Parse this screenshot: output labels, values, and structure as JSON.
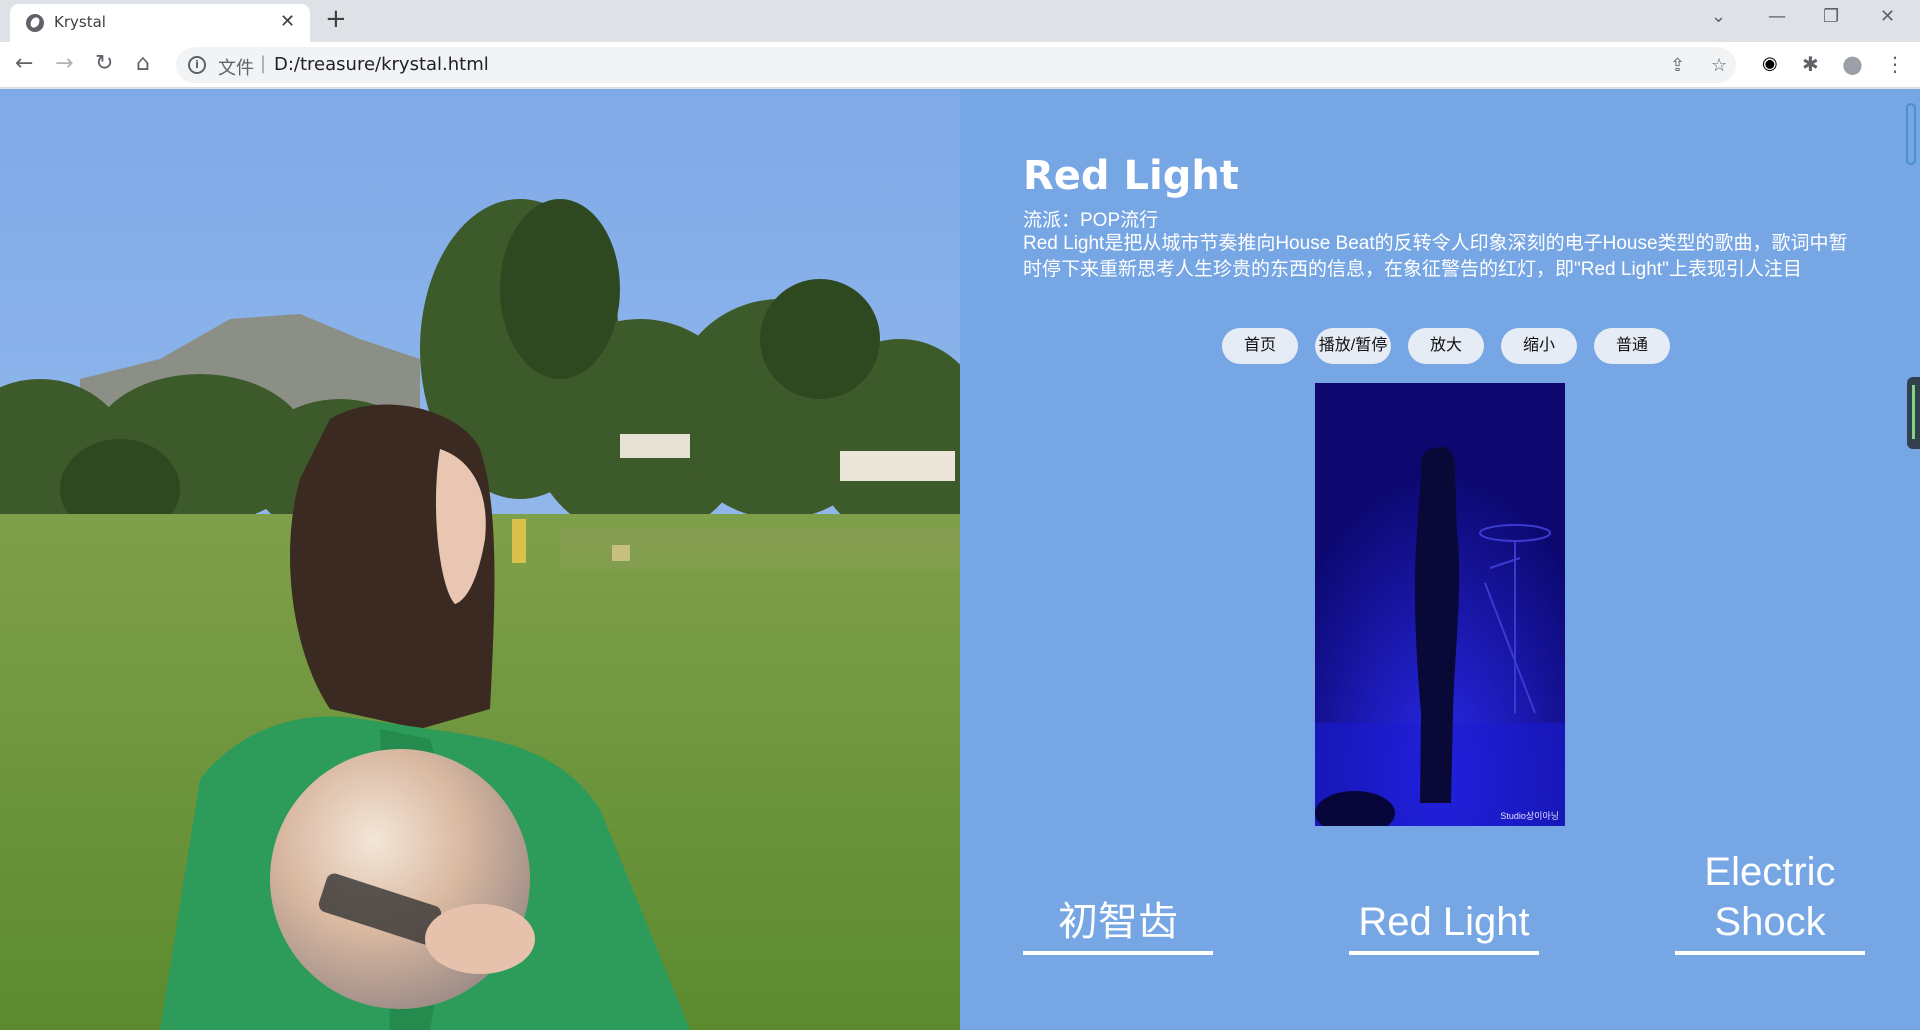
{
  "browser": {
    "tab_title": "Krystal",
    "tab_close": "✕",
    "new_tab": "+",
    "url_scheme": "文件",
    "url_separator": "|",
    "url_path": "D:/treasure/krystal.html",
    "window_controls": {
      "tab_search": "⌄",
      "minimize": "—",
      "restore": "❐",
      "close": "✕"
    },
    "nav": {
      "back": "←",
      "forward": "→",
      "reload": "↻",
      "home": "⌂"
    },
    "omnibox_right": {
      "share": "⇪",
      "bookmark": "☆"
    },
    "toolbar_right": {
      "extension_eye": "◉",
      "extensions": "✱",
      "profile": "●",
      "menu": "⋮"
    }
  },
  "page": {
    "song_title": "Red Light",
    "genre": "流派：POP流行",
    "description": "Red Light是把从城市节奏推向House Beat的反转令人印象深刻的电子House类型的歌曲，歌词中暂时停下来重新思考人生珍贵的东西的信息，在象征警告的红灯，即\"Red Light\"上表现引人注目",
    "controls": [
      "首页",
      "播放/暂停",
      "放大",
      "缩小",
      "普通"
    ],
    "video_watermark": "Studio상이아닝",
    "song_links": [
      {
        "label": "初智齿"
      },
      {
        "label": "Red Light"
      },
      {
        "label": "Electric Shock"
      }
    ],
    "colors": {
      "background": "#77a6e4",
      "text": "#ffffff",
      "button": "#e6ecf5"
    }
  }
}
